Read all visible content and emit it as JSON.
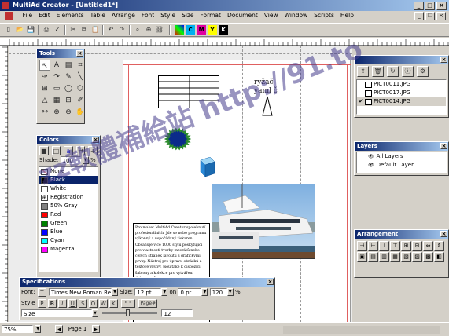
{
  "app": {
    "title": "MultiAd Creator - [Untitled1*]",
    "colors": {
      "titlebar": "#0a246a",
      "chrome": "#d4d0c8",
      "page_border": "#cc3333"
    }
  },
  "menu": [
    "File",
    "Edit",
    "Elements",
    "Table",
    "Arrange",
    "Font",
    "Style",
    "Size",
    "Format",
    "Document",
    "View",
    "Window",
    "Scripts",
    "Help"
  ],
  "toolbar": {
    "icons": [
      "new-icon",
      "open-icon",
      "save-icon",
      "print-icon",
      "spellcheck-icon",
      "cut-icon",
      "copy-icon",
      "paste-icon",
      "undo-icon",
      "redo-icon",
      "find-icon",
      "zoom-icon",
      "link-icon"
    ],
    "color_swatches": [
      {
        "label": "C",
        "color": "#00b0f0"
      },
      {
        "label": "M",
        "color": "#e000a0"
      },
      {
        "label": "Y",
        "color": "#ffff00"
      },
      {
        "label": "K",
        "color": "#000000"
      }
    ]
  },
  "tools_palette": {
    "title": "Tools",
    "icons": [
      "pointer-icon",
      "select-icon",
      "text-icon",
      "crop-icon",
      "pen-icon",
      "rotate-icon",
      "brush-icon",
      "line-icon",
      "frame-icon",
      "rect-icon",
      "ellipse-icon",
      "polygon-icon",
      "triangle-icon",
      "table-icon",
      "grid-icon",
      "pencil-icon",
      "link-icon",
      "zoom-in-icon",
      "zoom-out-icon",
      "hand-icon"
    ],
    "glyphs": [
      "↖",
      "A",
      "▤",
      "⌗",
      "✑",
      "↷",
      "✎",
      "╲",
      "⊞",
      "▭",
      "◯",
      "⬡",
      "△",
      "▦",
      "⊟",
      "✐",
      "⚯",
      "⊕",
      "⊖",
      "✋"
    ]
  },
  "colors_palette": {
    "title": "Colors",
    "shade_label": "Shade:",
    "shade_value": "100",
    "shade_unit": "%",
    "items": [
      {
        "name": "None",
        "color": "#ffffff"
      },
      {
        "name": "Black",
        "color": "#000000"
      },
      {
        "name": "White",
        "color": "#ffffff"
      },
      {
        "name": "Registration",
        "color": "#000000"
      },
      {
        "name": "50% Gray",
        "color": "#808080"
      },
      {
        "name": "Red",
        "color": "#ff0000"
      },
      {
        "name": "Green",
        "color": "#008000"
      },
      {
        "name": "Blue",
        "color": "#0000ff"
      },
      {
        "name": "Cyan",
        "color": "#00ffff"
      },
      {
        "name": "Magenta",
        "color": "#ff00ff"
      }
    ],
    "selected": "Black"
  },
  "images_panel": {
    "files": [
      "PICT0011.JPG",
      "PICT0017.JPG",
      "PICT0014.JPG"
    ],
    "checked": "PICT0014.JPG"
  },
  "layers_panel": {
    "title": "Layers",
    "items": [
      "All Layers",
      "Default Layer"
    ]
  },
  "arrangement_panel": {
    "title": "Arrangement"
  },
  "document": {
    "heading_text": "ryžač\nyaml č",
    "body_text": "Pro maket MultiAd Creator spolehnutí profesionálních. Jde se nebo programu výkonný a uspořádaný tiskaren. Obsahuje více 1000 stylů poskytující pro vlastnosti tvorby inzerátů nebo celých stránek layoutu s grafickými prvky. Nástroj pro úpravu obrázků a textové vrstvy. Jsou také k dispozici šablony a kolekce pro vytváření dokumentů."
  },
  "specifications": {
    "title": "Specifications",
    "font_label": "Font:",
    "font_value": "Times New Roman Re",
    "size_label": "Size:",
    "size_value": "12 pt",
    "lead_label": "on",
    "lead_value": "0 pt",
    "scale_value": "120",
    "percent": "%",
    "style_label": "Style",
    "style_buttons": [
      "P",
      "B",
      "I",
      "U",
      "S",
      "O",
      "W",
      "K"
    ],
    "quote_button": "\" \"",
    "page_button": "Page#",
    "slider_label": "Size",
    "slider_value": "12"
  },
  "status": {
    "zoom": "75%",
    "page": "Page 1"
  },
  "watermark": "zz軟體補給站 http://91.to"
}
